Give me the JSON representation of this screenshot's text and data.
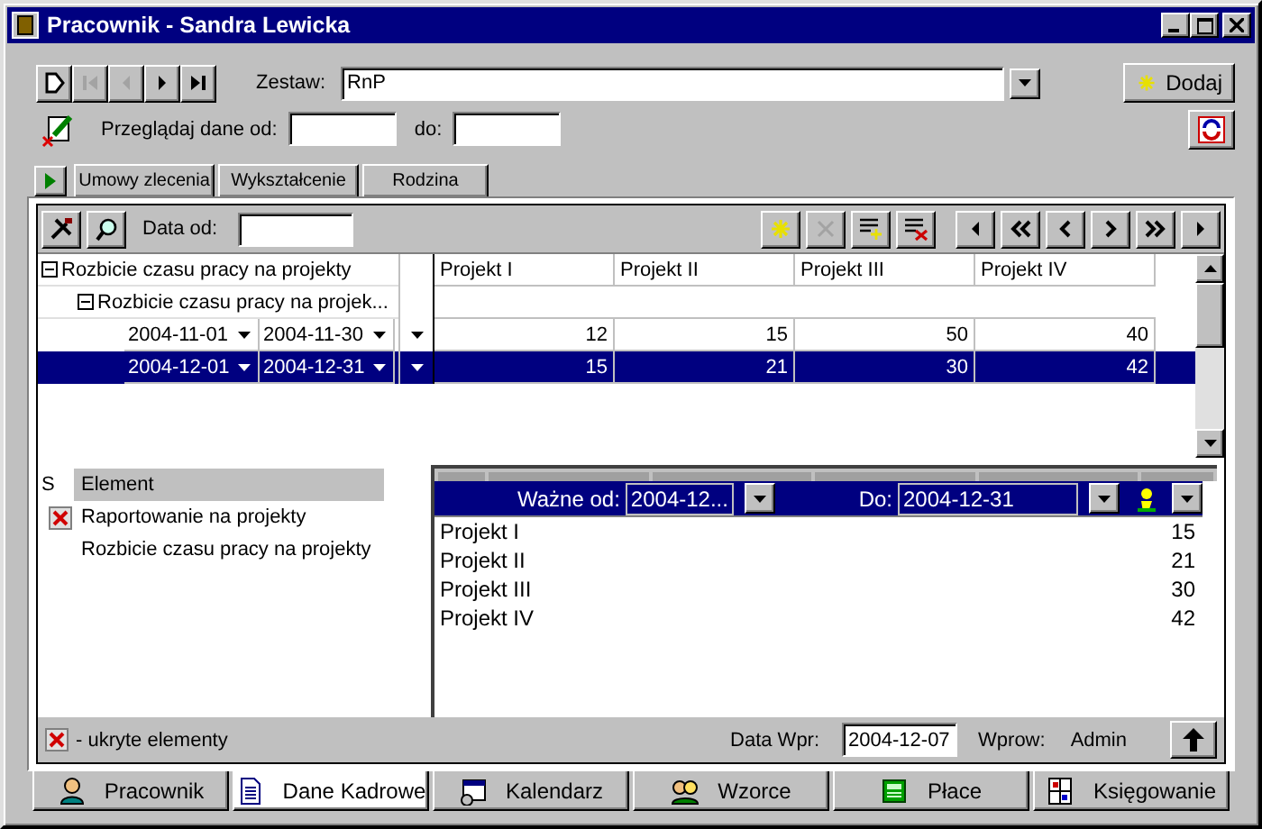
{
  "window": {
    "title": "Pracownik - Sandra Lewicka"
  },
  "nav_buttons": [
    {
      "kind": "new",
      "disabled": false
    },
    {
      "kind": "first",
      "disabled": true
    },
    {
      "kind": "prev",
      "disabled": true
    },
    {
      "kind": "next",
      "disabled": false
    },
    {
      "kind": "last",
      "disabled": false
    }
  ],
  "set": {
    "label": "Zestaw:",
    "value": "RnP"
  },
  "add_button": {
    "label": "Dodaj"
  },
  "browse": {
    "label": "Przeglądaj dane od:",
    "to_label": "do:"
  },
  "tabs": [
    {
      "label": "Umowy zlecenia",
      "selected": false
    },
    {
      "label": "Wykształcenie",
      "selected": false
    },
    {
      "label": "Rodzina",
      "selected": false
    }
  ],
  "grid_toolbar": {
    "left_buttons": [
      {
        "kind": "tools",
        "disabled": false
      },
      {
        "kind": "search",
        "disabled": false
      }
    ],
    "date_label": "Data od:",
    "buttons": [
      {
        "kind": "new",
        "disabled": false
      },
      {
        "kind": "delete",
        "disabled": true
      },
      {
        "kind": "add-row",
        "disabled": false
      },
      {
        "kind": "remove-row",
        "disabled": false
      },
      {
        "kind": "prev",
        "disabled": false
      },
      {
        "kind": "first-page",
        "disabled": false
      },
      {
        "kind": "prev-page",
        "disabled": false
      },
      {
        "kind": "next-page",
        "disabled": false
      },
      {
        "kind": "last-page",
        "disabled": false
      },
      {
        "kind": "next",
        "disabled": false
      }
    ]
  },
  "grid": {
    "columns": [
      "Projekt I",
      "Projekt II",
      "Projekt III",
      "Projekt IV"
    ],
    "tree": [
      {
        "label": "Rozbicie czasu pracy na projekty",
        "expanded": true,
        "children": [
          {
            "label": "Rozbicie czasu pracy na projek...",
            "expanded": true,
            "children": [
              {
                "from": "2004-11-01",
                "to": "2004-11-30",
                "values": [
                  "12",
                  "15",
                  "50",
                  "40"
                ],
                "selected": false
              },
              {
                "from": "2004-12-01",
                "to": "2004-12-31",
                "values": [
                  "15",
                  "21",
                  "30",
                  "42"
                ],
                "selected": true
              }
            ]
          }
        ]
      }
    ]
  },
  "elements": {
    "columns": [
      "S",
      "Element"
    ],
    "items": [
      {
        "label": "Raportowanie na projekty",
        "hidden": true
      },
      {
        "label": "Rozbicie czasu pracy na projekty",
        "hidden": false
      }
    ]
  },
  "detail": {
    "valid_from_label": "Ważne od:",
    "valid_from": "2004-12...",
    "to_label": "Do:",
    "to": "2004-12-31",
    "rows": [
      {
        "name": "Projekt I",
        "value": "15"
      },
      {
        "name": "Projekt II",
        "value": "21"
      },
      {
        "name": "Projekt III",
        "value": "30"
      },
      {
        "name": "Projekt IV",
        "value": "42"
      }
    ]
  },
  "status": {
    "legend": "- ukryte elementy",
    "date_label": "Data Wpr:",
    "date": "2004-12-07",
    "author_label": "Wprow:",
    "author": "Admin"
  },
  "bottom_tabs": [
    {
      "label": "Pracownik",
      "kind": "person",
      "selected": false
    },
    {
      "label": "Dane Kadrowe",
      "kind": "document",
      "selected": true
    },
    {
      "label": "Kalendarz",
      "kind": "calendar",
      "selected": false
    },
    {
      "label": "Wzorce",
      "kind": "people",
      "selected": false
    },
    {
      "label": "Płace",
      "kind": "calculator",
      "selected": false
    },
    {
      "label": "Księgowanie",
      "kind": "ledger",
      "selected": false
    }
  ]
}
